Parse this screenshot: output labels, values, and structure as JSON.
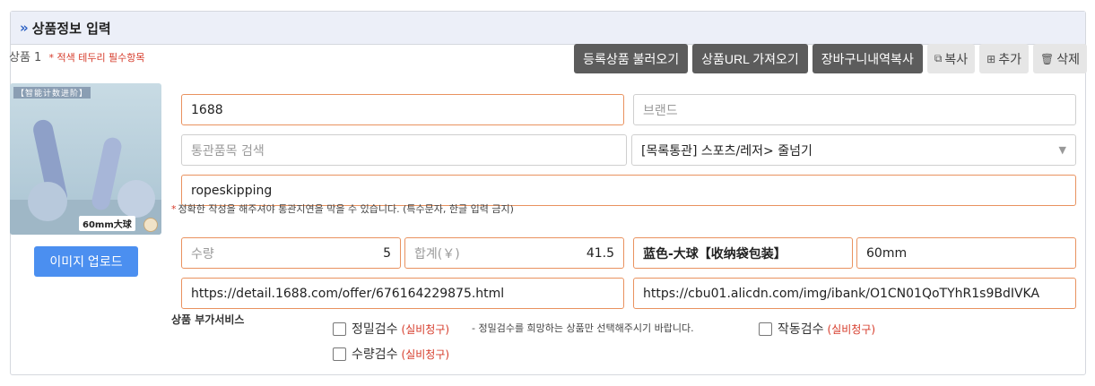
{
  "header": {
    "chevron": "»",
    "title": "상품정보 입력"
  },
  "product": {
    "label": "상품 1",
    "required_note": "* 적색 테두리 필수항목"
  },
  "toolbar": {
    "load_registered": "등록상품 불러오기",
    "fetch_url": "상품URL 가져오기",
    "copy_cart": "장바구니내역복사",
    "copy": "복사",
    "add": "추가",
    "delete": "삭제"
  },
  "thumbnail": {
    "top_text": "【智能计数进阶】",
    "bottom_text": "60mm大球"
  },
  "upload": {
    "label": "이미지 업로드"
  },
  "fields": {
    "shop": {
      "value": "1688"
    },
    "brand": {
      "placeholder": "브랜드"
    },
    "customs_search": {
      "placeholder": "통관품목 검색"
    },
    "customs_category": {
      "value": "[목록통관] 스포츠/레저> 줄넘기"
    },
    "english_name": {
      "value": "ropeskipping"
    },
    "hint": {
      "mark": "*",
      "text": "정확한 작성을 해주셔야 통관지연을 막을 수 있습니다. (특수문자, 한글 입력 금지)"
    },
    "quantity": {
      "label": "수량",
      "value": "5"
    },
    "total": {
      "label": "합계(￥)",
      "value": "41.5"
    },
    "option_color": {
      "value": "蓝色-大球【收纳袋包装】"
    },
    "option_size": {
      "value": "60mm"
    },
    "product_url": {
      "value": "https://detail.1688.com/offer/676164229875.html"
    },
    "image_url": {
      "value": "https://cbu01.alicdn.com/img/ibank/O1CN01QoTYhR1s9BdIVKA"
    }
  },
  "services": {
    "label": "상품 부가서비스",
    "precision": {
      "label": "정밀검수",
      "paid": "(실비청구)"
    },
    "precision_note": "- 정밀검수를 희망하는 상품만 선택해주시기 바랍니다.",
    "operation": {
      "label": "작동검수",
      "paid": "(실비청구)"
    },
    "quantity_check": {
      "label": "수량검수",
      "paid": "(실비청구)"
    }
  },
  "colors": {
    "accent_blue": "#4b8ff0",
    "required_border": "#e9925f",
    "required_text": "#d63b2a",
    "dark_button": "#5c5c5c"
  }
}
